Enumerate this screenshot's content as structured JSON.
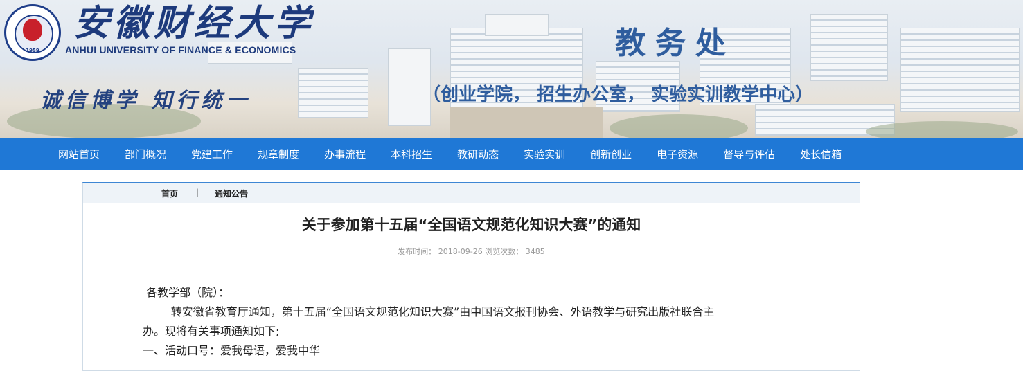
{
  "header": {
    "university_cn": "安徽财经大学",
    "university_en": "ANHUI UNIVERSITY OF FINANCE & ECONOMICS",
    "seal_year": "1959",
    "motto": "诚信博学 知行统一",
    "department": "教务处",
    "sub_departments": "（创业学院， 招生办公室， 实验实训教学中心）"
  },
  "nav": {
    "items": [
      "网站首页",
      "部门概况",
      "党建工作",
      "规章制度",
      "办事流程",
      "本科招生",
      "教研动态",
      "实验实训",
      "创新创业",
      "电子资源",
      "督导与评估",
      "处长信箱"
    ]
  },
  "breadcrumb": {
    "home": "首页",
    "separator": "|",
    "current": "通知公告"
  },
  "article": {
    "title": "关于参加第十五届“全国语文规范化知识大赛”的通知",
    "meta": "发布时间： 2018-09-26 浏览次数： 3485",
    "paragraphs": [
      " 各教学部（院）：",
      "        转安徽省教育厅通知，第十五届“全国语文规范化知识大赛”由中国语文报刊协会、外语教学与研究出版社联合主",
      "办。现将有关事项通知如下;",
      "一、活动口号：爱我母语，爱我中华"
    ]
  },
  "colors": {
    "nav_bg": "#1f78d6",
    "brand_blue": "#1d3a7c",
    "seal_red": "#c8202b"
  }
}
